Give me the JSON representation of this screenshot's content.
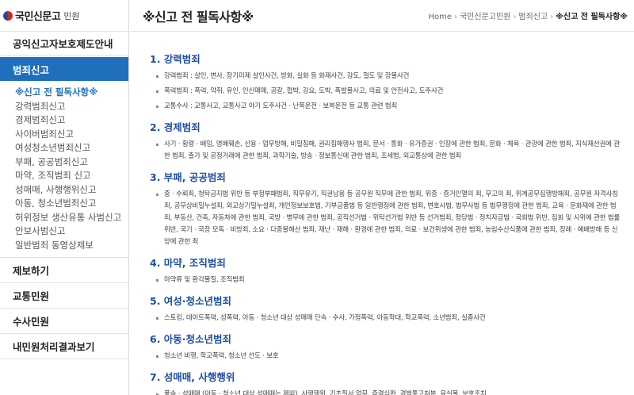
{
  "brand": {
    "name": "국민신문고",
    "sub": "민원"
  },
  "sidebar": {
    "title": "공익신고자보호제도안내",
    "active_category": "범죄신고",
    "sub_items": [
      {
        "label": "※신고 전 필독사항※",
        "current": true
      },
      {
        "label": "강력범죄신고"
      },
      {
        "label": "경제범죄신고"
      },
      {
        "label": "사이버범죄신고"
      },
      {
        "label": "여성청소년범죄신고"
      },
      {
        "label": "부패, 공공범죄신고"
      },
      {
        "label": "마약, 조직범죄 신고"
      },
      {
        "label": "성매매, 사행행위신고"
      },
      {
        "label": "아동, 청소년범죄신고"
      },
      {
        "label": "허위정보 생산유통 사범신고"
      },
      {
        "label": "안보사범신고"
      },
      {
        "label": "일반범죄 동영상제보"
      }
    ],
    "menus": [
      {
        "label": "제보하기"
      },
      {
        "label": "교통민원"
      },
      {
        "label": "수사민원"
      },
      {
        "label": "내민원처리결과보기"
      }
    ]
  },
  "header": {
    "title": "※신고 전 필독사항※",
    "breadcrumb": [
      "Home",
      "국민신문고민원",
      "범죄신고",
      "※신고 전 필독사항※"
    ]
  },
  "sections": [
    {
      "title": "1. 강력범죄",
      "bullets": [
        "강력범죄 : 살인, 변사, 장기미제 살인사건, 방화, 실화 등 화재사건, 강도, 절도 및 장물사건",
        "폭력범죄 : 폭력, 약취, 유인, 인신매매, 공갈, 협박, 강요, 도박, 폭발물사고, 의료 및 안전사고, 도주사건",
        "교통수사 : 교통사고, 교통사고 야기 도주사건 · 난폭운전 · 보복운전 등 교통 관련 범죄"
      ]
    },
    {
      "title": "2. 경제범죄",
      "bullets": [
        "사기 · 횡령 · 배임, 명예훼손, 신용 · 업무방해, 비밀침해, 권리침해행사 범죄, 문서 · 통화 · 유가증권 · 인장에 관한 범죄, 문화 · 체육 · 관광에 관한 범죄, 지식재산권에 관한 범죄, 출가 및 공정거래에 관한 범죄, 과학기술, 방송 · 정보통신에 관한 범죄, 조세범, 외교통상에 관한 범죄"
      ]
    },
    {
      "title": "3. 부패, 공공범죄",
      "bullets": [
        "중 · 수뢰죄, 청탁금지법 위반 등 부정부패범죄, 직무유기, 직권남용 등 공무원 직무에 관한 범죄, 위증 · 증거인멸의 죄, 무고의 죄, 위계공무집행방해죄, 공무원 자격사칭죄, 공무상비밀누설죄, 외교상기밀누설죄, 개인정보보호법, 기부금품법 등 일반행정에 관한 범죄, 변호사법, 법무사법 등 법무행정에 관한 범죄, 교육 · 문화재에 관한 범죄, 부동산, 건축, 자동차에 관한 범죄, 국방 · 병무에 관한 범죄, 공직선거법 · 위탁선거법 위반 등 선거범죄, 정당법 · 정치자금법 · 국회법 위반, 집회 및 시위에 관한 법률 위반, 국기 · 국장 모독 · 비방죄, 소요 · 다중불해산 범죄, 재난 · 재해 · 환경에 관한 범죄, 의료 · 보건위생에 관한 범죄, 농림수산식품에 관한 범죄, 장례 · 예배방해 등 신앙에 관한 죄"
      ]
    },
    {
      "title": "4. 마약, 조직범죄",
      "bullets": [
        "마약류 및 환각물질, 조직범죄"
      ]
    },
    {
      "title": "5. 여성·청소년범죄",
      "bullets": [
        "스토킹, 데이트폭력, 성폭력, 아동 · 청소년 대상 성매매 단속 · 수사, 가정폭력, 아동학대, 학교폭력, 소년범죄, 실종사건"
      ]
    },
    {
      "title": "6. 아동·청소년범죄",
      "bullets": [
        "청소년 비행, 학교폭력, 청소년 선도 · 보호"
      ]
    },
    {
      "title": "7. 성매매, 사행행위",
      "bullets": [
        "풍속 · 성매매 (아동 · 청소년 대상 성매매는 제외), 사행행위, 기초질서 업무, 즉결심판, 경범통고처분, 유실물, 보호조치"
      ]
    }
  ]
}
